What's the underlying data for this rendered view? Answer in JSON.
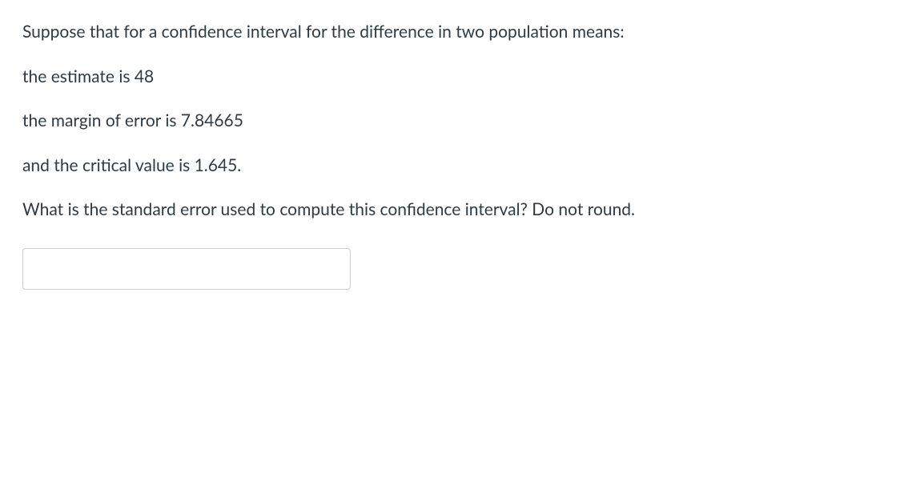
{
  "question": {
    "intro": "Suppose  that for a confidence interval for the difference in two population means:",
    "estimate_line": "the estimate is 48",
    "margin_line": "the margin of error is 7.84665",
    "critical_line": "and the critical value is 1.645.",
    "prompt": "What is the standard error used to compute this confidence interval? Do not round."
  },
  "answer": {
    "value": ""
  }
}
